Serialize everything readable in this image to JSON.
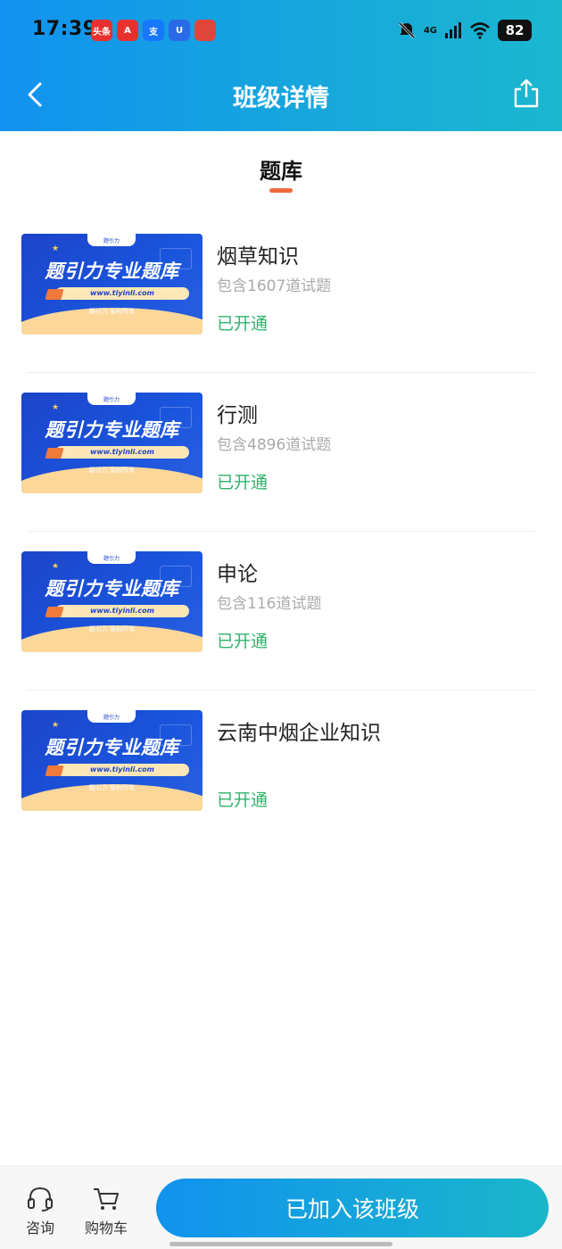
{
  "status_bar": {
    "time": "17:39",
    "notif_icons": [
      {
        "name": "toutiao-icon",
        "label": "头条",
        "color": "#e8312f"
      },
      {
        "name": "app-a-icon",
        "label": "A",
        "color": "#e8312f"
      },
      {
        "name": "alipay-icon",
        "label": "支",
        "color": "#1677ff"
      },
      {
        "name": "app-u-icon",
        "label": "U",
        "color": "#2a6ae8"
      },
      {
        "name": "app-red-icon",
        "label": "",
        "color": "#e0453a"
      }
    ],
    "network": "4G",
    "battery": "82"
  },
  "header": {
    "title": "班级详情",
    "back_icon": "chevron-left-icon",
    "share_icon": "share-icon"
  },
  "section": {
    "title": "题库",
    "underline_color": "#ee6a3f"
  },
  "thumbnail": {
    "brand": "题引力专业题库",
    "url": "www.tiyinli.com",
    "copyright": "题引力 版权所有",
    "tab": "题引力"
  },
  "items": [
    {
      "title": "烟草知识",
      "count": "包含1607道试题",
      "status": "已开通"
    },
    {
      "title": "行测",
      "count": "包含4896道试题",
      "status": "已开通"
    },
    {
      "title": "申论",
      "count": "包含116道试题",
      "status": "已开通"
    },
    {
      "title": "云南中烟企业知识",
      "count": "",
      "status": "已开通"
    }
  ],
  "bottom_bar": {
    "consult_label": "咨询",
    "cart_label": "购物车",
    "join_label": "已加入该班级"
  },
  "colors": {
    "accent": "#1292ef",
    "status_green": "#2fb36b"
  }
}
